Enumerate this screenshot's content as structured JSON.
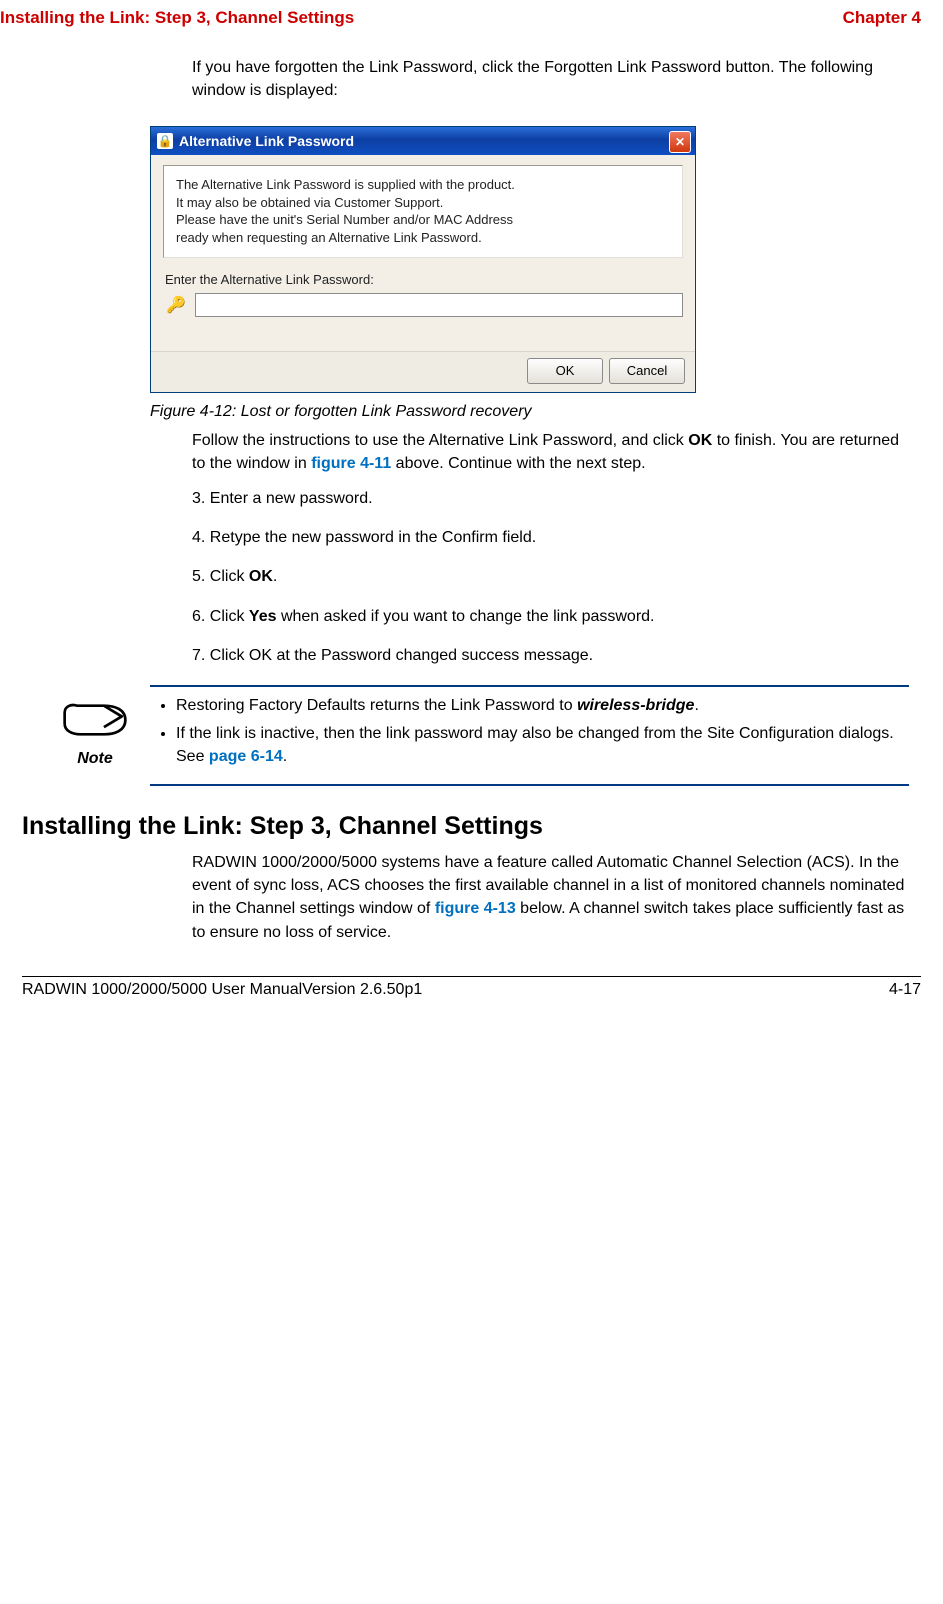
{
  "header": {
    "left": "Installing the Link: Step 3, Channel Settings",
    "right": "Chapter 4"
  },
  "intro_para": "If you have forgotten the Link Password, click the Forgotten Link Password button. The following window is displayed:",
  "dialog": {
    "title": "Alternative Link Password",
    "info_line1": "The Alternative Link Password is supplied with the product.",
    "info_line2": "It may also be obtained via Customer Support.",
    "info_line3": "Please have the unit's Serial Number and/or MAC Address",
    "info_line4": "ready when requesting an Alternative Link Password.",
    "prompt": "Enter the Alternative Link Password:",
    "input_value": "",
    "ok": "OK",
    "cancel": "Cancel"
  },
  "figure_caption": "Figure 4-12: Lost or forgotten Link Password recovery",
  "follow_para_pre": "Follow the instructions to use the Alternative Link Password, and click ",
  "follow_ok": "OK",
  "follow_para_mid": " to finish. You are returned to the window in ",
  "figure_ref": "figure 4-11",
  "follow_para_post": " above. Continue with the next step.",
  "step3": "3. Enter a new password.",
  "step4": "4. Retype the new password in the Confirm field.",
  "step5_pre": "5. Click ",
  "step5_ok": "OK",
  "step5_post": ".",
  "step6_pre": "6. Click ",
  "step6_yes": "Yes",
  "step6_post": " when asked if you want to change the link password.",
  "step7": "7. Click OK at the Password changed success message.",
  "note_label": "Note",
  "note_b1_pre": "Restoring Factory Defaults returns the Link Password to ",
  "note_b1_val": "wireless-bridge",
  "note_b1_post": ".",
  "note_b2_pre": "If the link is inactive, then the link password may also be changed from the Site Configuration dialogs. See ",
  "note_b2_ref": "page 6-14",
  "note_b2_post": ".",
  "section_heading": "Installing the Link: Step 3, Channel Settings",
  "section_para_pre": "RADWIN 1000/2000/5000 systems have a feature called Automatic Channel Selection (ACS). In the event of sync loss, ACS chooses the first available channel in a list of monitored channels nominated in the Channel settings window of ",
  "section_para_ref": "figure 4-13",
  "section_para_post": " below. A channel switch takes place sufficiently fast as to ensure no loss of service.",
  "footer": {
    "left": "RADWIN 1000/2000/5000 User ManualVersion  2.6.50p1",
    "right": "4-17"
  }
}
